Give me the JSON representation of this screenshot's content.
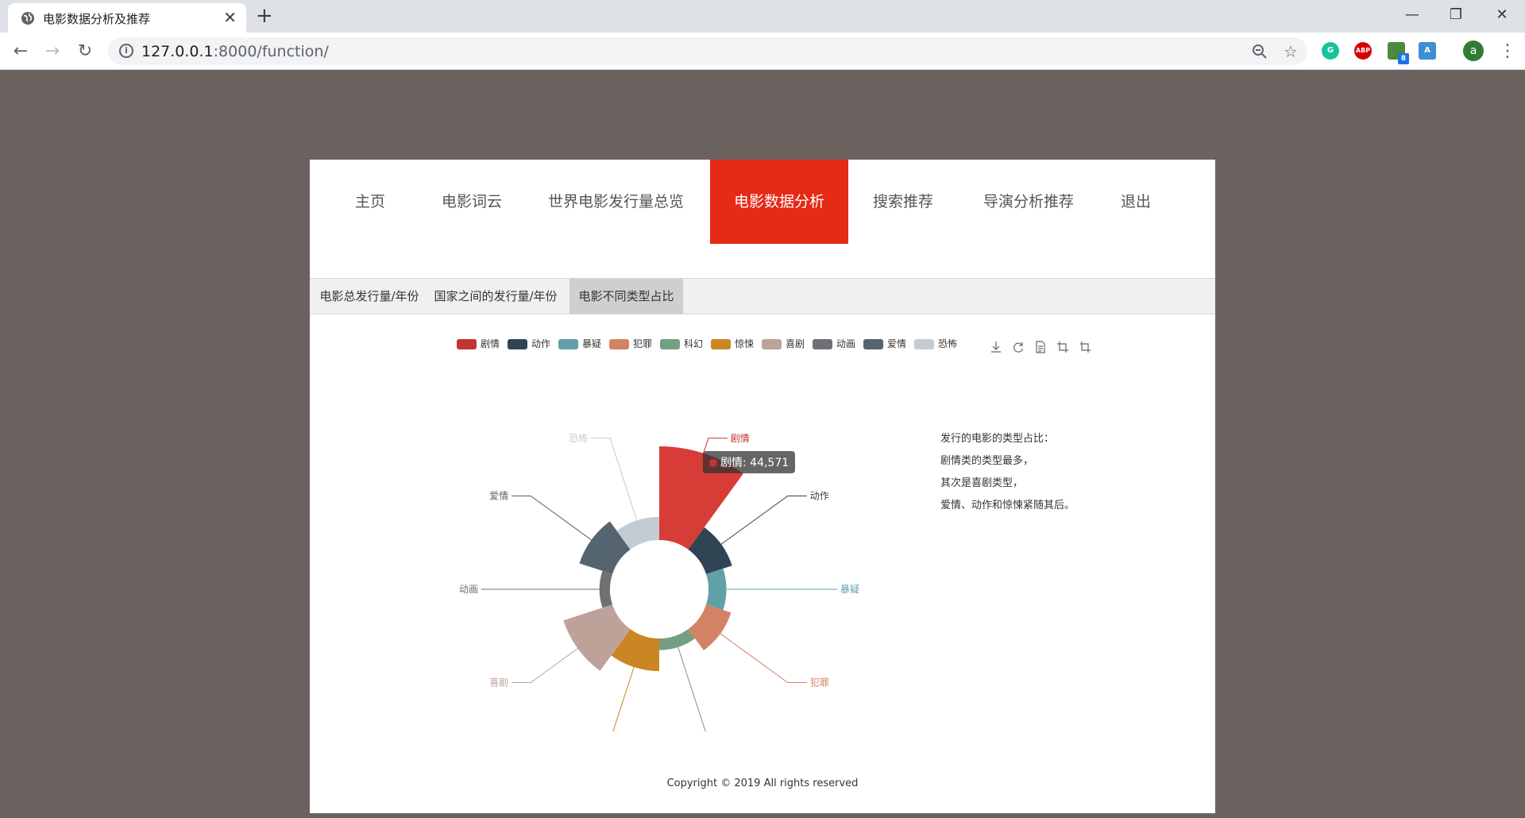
{
  "browser": {
    "tab_title": "电影数据分析及推荐",
    "url_host": "127.0.0.1",
    "url_rest": ":8000/function/",
    "profile_initial": "a",
    "ext_badge": "8"
  },
  "nav": {
    "items": [
      "主页",
      "电影词云",
      "世界电影发行量总览",
      "电影数据分析",
      "搜索推荐",
      "导演分析推荐",
      "退出"
    ],
    "active": "电影数据分析"
  },
  "subnav": {
    "items": [
      "电影总发行量/年份",
      "国家之间的发行量/年份",
      "电影不同类型占比"
    ],
    "active": "电影不同类型占比"
  },
  "chart_data": {
    "type": "pie",
    "rose_type": "radius",
    "categories": [
      "剧情",
      "动作",
      "暴疑",
      "犯罪",
      "科幻",
      "惊悚",
      "喜剧",
      "动画",
      "爱情",
      "恐怖"
    ],
    "values": [
      44571,
      13000,
      8500,
      12500,
      5500,
      15500,
      24500,
      5000,
      16500,
      11000
    ],
    "colors": [
      "#c23531",
      "#2f4554",
      "#61a0a8",
      "#d48265",
      "#749f83",
      "#ca8622",
      "#bda29a",
      "#6e7074",
      "#546570",
      "#c4ccd3"
    ],
    "legend_position": "top",
    "tooltip": "剧情: 44,571"
  },
  "description": {
    "lines": [
      "发行的电影的类型占比：",
      "剧情类的类型最多，",
      "其次是喜剧类型，",
      "爱情、动作和惊悚紧随其后。"
    ]
  },
  "footer": "Copyright © 2019 All rights reserved"
}
